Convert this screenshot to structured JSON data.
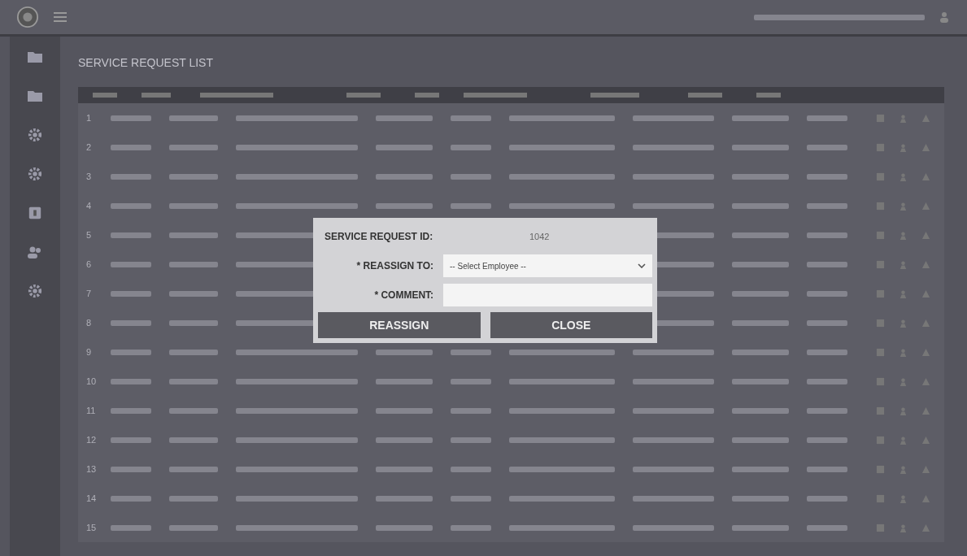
{
  "page": {
    "title": "SERVICE REQUEST LIST"
  },
  "sidebar": {
    "items": [
      {
        "kind": "folder"
      },
      {
        "kind": "folder"
      },
      {
        "kind": "gear"
      },
      {
        "kind": "gear"
      },
      {
        "kind": "box"
      },
      {
        "kind": "users"
      },
      {
        "kind": "gear"
      }
    ]
  },
  "table": {
    "rows": [
      {
        "number": "1"
      },
      {
        "number": "2"
      },
      {
        "number": "3"
      },
      {
        "number": "4"
      },
      {
        "number": "5"
      },
      {
        "number": "6"
      },
      {
        "number": "7"
      },
      {
        "number": "8"
      },
      {
        "number": "9"
      },
      {
        "number": "10"
      },
      {
        "number": "11"
      },
      {
        "number": "12"
      },
      {
        "number": "13"
      },
      {
        "number": "14"
      },
      {
        "number": "15"
      }
    ]
  },
  "dialog": {
    "id_label": "SERVICE REQUEST ID:",
    "id_value": "1042",
    "reassign_label": "* REASSIGN TO:",
    "employee_select": {
      "value": "-- Select Employee --"
    },
    "comment_label": "* COMMENT:",
    "comment_field": {
      "kind": "text"
    },
    "buttons": [
      "REASSIGN",
      "CLOSE"
    ]
  }
}
